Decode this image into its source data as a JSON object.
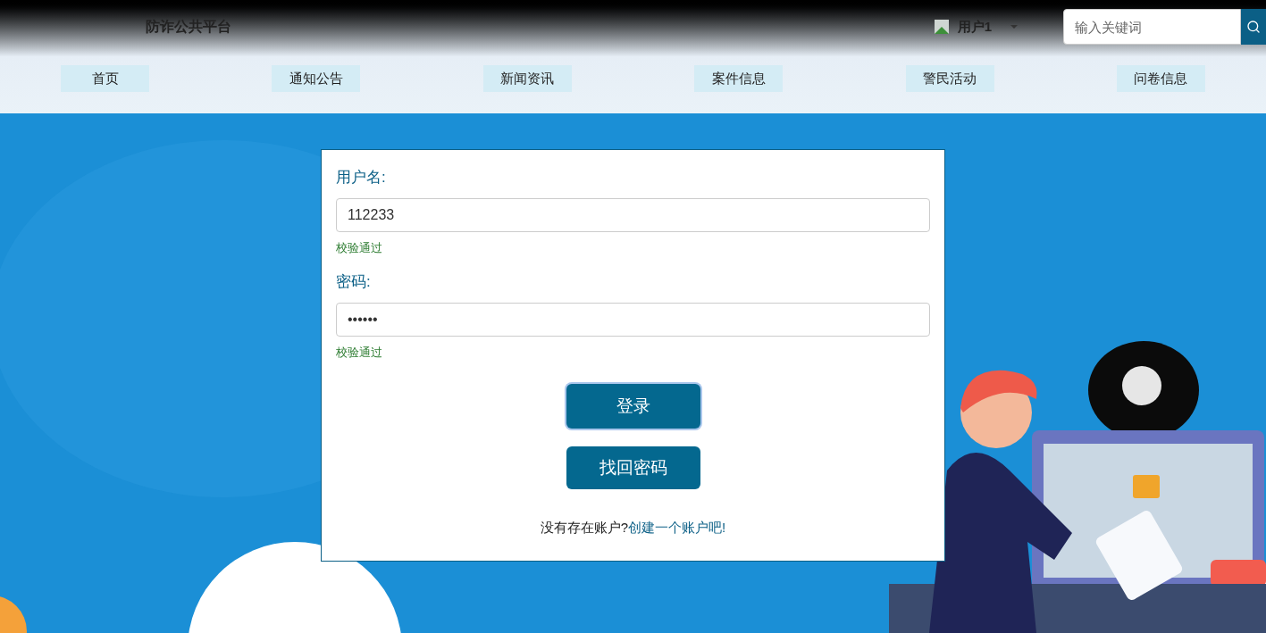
{
  "header": {
    "site_title": "防诈公共平台",
    "user": {
      "name": "用户1"
    },
    "search": {
      "placeholder": "输入关键词"
    }
  },
  "nav": [
    {
      "label": "首页"
    },
    {
      "label": "通知公告"
    },
    {
      "label": "新闻资讯"
    },
    {
      "label": "案件信息"
    },
    {
      "label": "警民活动"
    },
    {
      "label": "问卷信息"
    }
  ],
  "login_form": {
    "fields": [
      {
        "label": "用户名:",
        "value": "112233",
        "hint": "校验通过"
      },
      {
        "label": "密码:",
        "value": "••••••",
        "hint": "校验通过"
      }
    ],
    "buttons": [
      {
        "label": "登录",
        "focused": true
      },
      {
        "label": "找回密码",
        "focused": false
      }
    ],
    "signup_prompt": "没有存在账户?",
    "signup_link": "创建一个账户吧!"
  }
}
